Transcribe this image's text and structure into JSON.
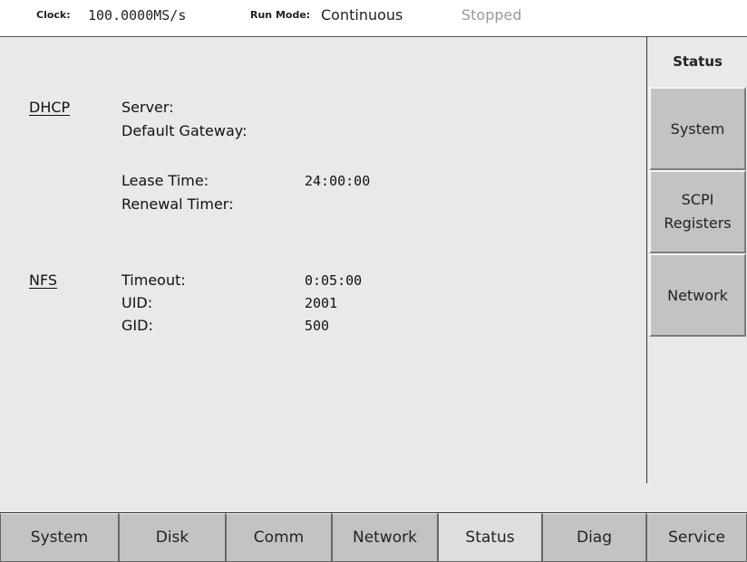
{
  "header": {
    "clock_label": "Clock:",
    "clock_value": "100.0000MS/s",
    "run_mode_label": "Run Mode:",
    "run_mode_value": "Continuous",
    "state": "Stopped"
  },
  "dhcp": {
    "section_label": "DHCP",
    "server_label": "Server:",
    "gateway_label": "Default Gateway:",
    "lease_label": "Lease Time:",
    "lease_value": "24:00:00",
    "renewal_label": "Renewal Timer:"
  },
  "nfs": {
    "section_label": "NFS",
    "timeout_label": "Timeout:",
    "timeout_value": "0:05:00",
    "uid_label": "UID:",
    "uid_value": "2001",
    "gid_label": "GID:",
    "gid_value": "500"
  },
  "side_menu": {
    "title": "Status",
    "system": "System",
    "scpi_line1": "SCPI",
    "scpi_line2": "Registers",
    "network": "Network"
  },
  "bottom_tabs": {
    "system": "System",
    "disk": "Disk",
    "comm": "Comm",
    "network": "Network",
    "status": "Status",
    "diag": "Diag",
    "service": "Service"
  }
}
